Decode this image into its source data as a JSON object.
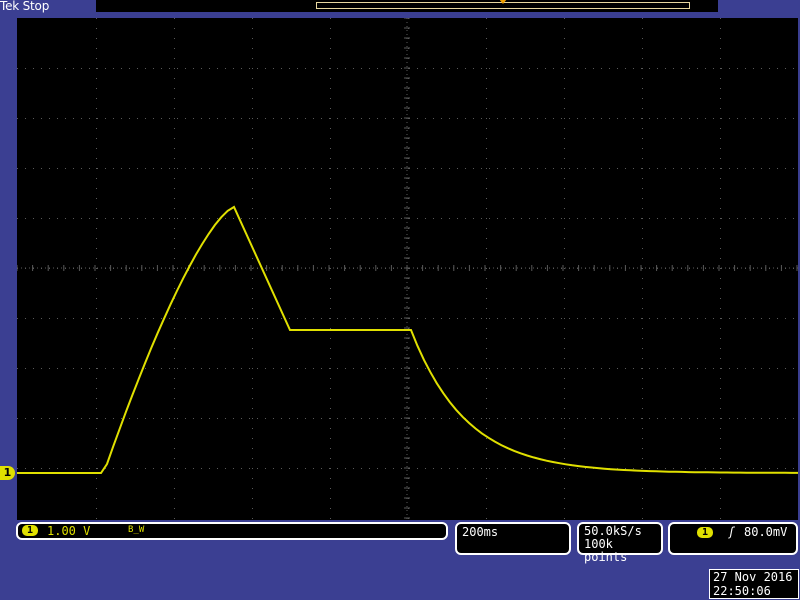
{
  "header": {
    "brand": "Tek Stop"
  },
  "channel1": {
    "marker_label": "1",
    "badge": "1",
    "scale": "1.00 V",
    "bandwidth_icon": "B_W"
  },
  "horizontal": {
    "time_per_div": "200ms"
  },
  "acquisition": {
    "sample_rate": "50.0kS/s",
    "record_length": "100k points"
  },
  "trigger": {
    "source": "1",
    "slope_symbol": "ʃ",
    "level": "80.0mV"
  },
  "timestamp": {
    "date": "27 Nov 2016",
    "time": "22:50:06"
  },
  "colors": {
    "trace": "#e0e000",
    "graticule": "#5a5a5a",
    "background": "#3b3f92"
  }
}
